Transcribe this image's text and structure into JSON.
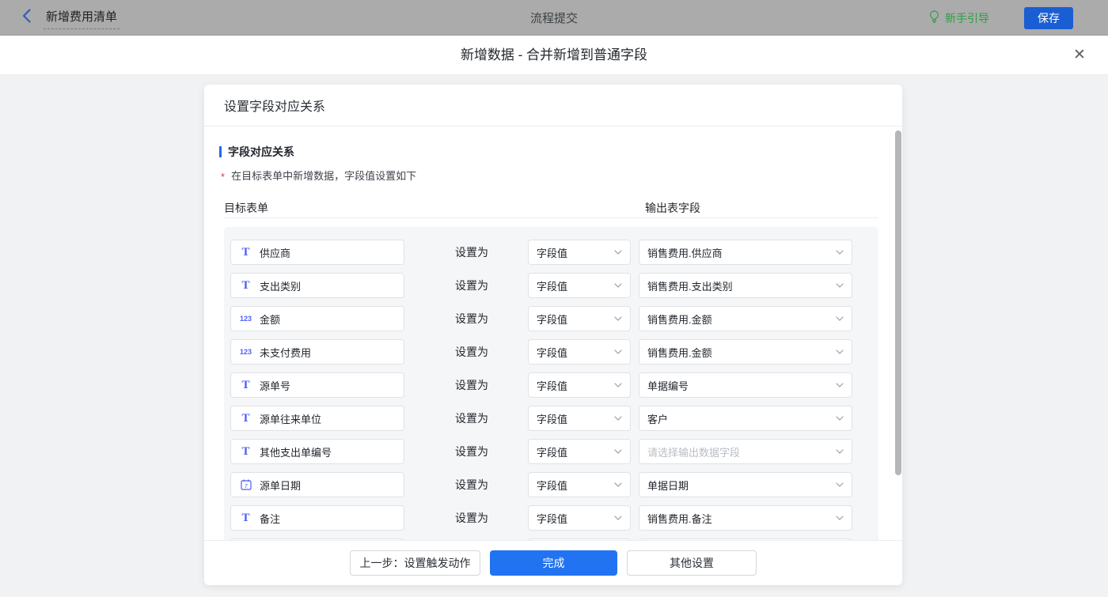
{
  "topbar": {
    "back_label": "新增费用清单",
    "center_title": "流程提交",
    "guide_label": "新手引导",
    "save_label": "保存"
  },
  "dialog": {
    "title": "新增数据 - 合并新增到普通字段",
    "close_glyph": "✕"
  },
  "card": {
    "header_title": "设置字段对应关系",
    "section_title": "字段对应关系",
    "required_mark": "*",
    "hint": "在目标表单中新增数据，字段值设置如下",
    "columns": {
      "target": "目标表单",
      "output": "输出表字段"
    },
    "set_as_label": "设置为",
    "rows": [
      {
        "icon": "text",
        "field": "供应商",
        "mode": "字段值",
        "output": "销售费用.供应商"
      },
      {
        "icon": "text",
        "field": "支出类别",
        "mode": "字段值",
        "output": "销售费用.支出类别"
      },
      {
        "icon": "number",
        "field": "金额",
        "mode": "字段值",
        "output": "销售费用.金额"
      },
      {
        "icon": "number",
        "field": "未支付费用",
        "mode": "字段值",
        "output": "销售费用.金额"
      },
      {
        "icon": "text",
        "field": "源单号",
        "mode": "字段值",
        "output": "单据编号"
      },
      {
        "icon": "text",
        "field": "源单往来单位",
        "mode": "字段值",
        "output": "客户"
      },
      {
        "icon": "text",
        "field": "其他支出单编号",
        "mode": "字段值",
        "output": "请选择输出数据字段",
        "output_is_placeholder": true
      },
      {
        "icon": "date",
        "field": "源单日期",
        "mode": "字段值",
        "output": "单据日期"
      },
      {
        "icon": "text",
        "field": "备注",
        "mode": "字段值",
        "output": "销售费用.备注"
      },
      {
        "icon": null,
        "field": "",
        "mode": "",
        "output": "",
        "partial": true
      }
    ],
    "footer": {
      "prev_label": "上一步：设置触发动作",
      "done_label": "完成",
      "other_label": "其他设置"
    }
  },
  "colors": {
    "accent_blue": "#2468f2",
    "primary_button_blue": "#2173f2",
    "save_button_blue": "#1a5ed3",
    "guide_green": "#2f9e44",
    "required_red": "#f2323e",
    "field_icon_blue": "#4d5ef7"
  }
}
